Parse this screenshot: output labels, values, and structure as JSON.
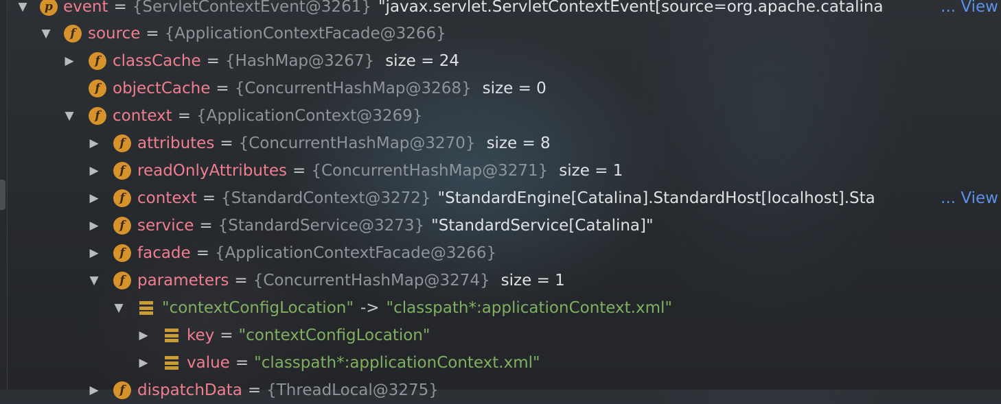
{
  "tree": {
    "event": {
      "name": "event",
      "type": "{ServletContextEvent@3261}",
      "value": "\"javax.servlet.ServletContextEvent[source=org.apache.catalina",
      "view": "... View"
    },
    "source": {
      "name": "source",
      "type": "{ApplicationContextFacade@3266}"
    },
    "classCache": {
      "name": "classCache",
      "type": "{HashMap@3267}",
      "value": "size = 24"
    },
    "objectCache": {
      "name": "objectCache",
      "type": "{ConcurrentHashMap@3268}",
      "value": "size = 0"
    },
    "context_outer": {
      "name": "context",
      "type": "{ApplicationContext@3269}"
    },
    "attributes": {
      "name": "attributes",
      "type": "{ConcurrentHashMap@3270}",
      "value": "size = 8"
    },
    "readOnlyAttributes": {
      "name": "readOnlyAttributes",
      "type": "{ConcurrentHashMap@3271}",
      "value": "size = 1"
    },
    "context_inner": {
      "name": "context",
      "type": "{StandardContext@3272}",
      "value": "\"StandardEngine[Catalina].StandardHost[localhost].Sta",
      "view": "... View"
    },
    "service": {
      "name": "service",
      "type": "{StandardService@3273}",
      "value": "\"StandardService[Catalina]\""
    },
    "facade": {
      "name": "facade",
      "type": "{ApplicationContextFacade@3266}"
    },
    "parameters": {
      "name": "parameters",
      "type": "{ConcurrentHashMap@3274}",
      "value": "size = 1"
    },
    "entry": {
      "key": "\"contextConfigLocation\"",
      "arrow": "->",
      "value": "\"classpath*:applicationContext.xml\""
    },
    "key": {
      "name": "key",
      "value": "\"contextConfigLocation\""
    },
    "value": {
      "name": "value",
      "value": "\"classpath*:applicationContext.xml\""
    },
    "dispatchData": {
      "name": "dispatchData",
      "type": "{ThreadLocal@3275}"
    }
  },
  "glyphs": {
    "expanded": "▼",
    "collapsed": "▶",
    "field_icon": "f",
    "param_icon": "p",
    "equals": "="
  }
}
